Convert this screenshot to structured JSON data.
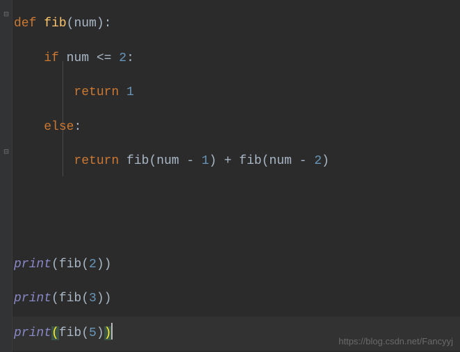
{
  "code": {
    "line1": {
      "kw_def": "def",
      "fn_name": "fib",
      "paren_open": "(",
      "param": "num",
      "paren_close": ")",
      "colon": ":"
    },
    "line2": {
      "kw_if": "if",
      "var": "num",
      "op": "<=",
      "num": "2",
      "colon": ":"
    },
    "line3": {
      "kw_return": "return",
      "num": "1"
    },
    "line4": {
      "kw_else": "else",
      "colon": ":"
    },
    "line5": {
      "kw_return": "return",
      "fn": "fib",
      "po1": "(",
      "var1": "num",
      "minus1": "-",
      "n1": "1",
      "pc1": ")",
      "plus": "+",
      "fn2": "fib",
      "po2": "(",
      "var2": "num",
      "minus2": "-",
      "n2": "2",
      "pc2": ")"
    },
    "line6": {
      "print": "print",
      "po": "(",
      "fn": "fib",
      "po2": "(",
      "num": "2",
      "pc2": ")",
      "pc": ")"
    },
    "line7": {
      "print": "print",
      "po": "(",
      "fn": "fib",
      "po2": "(",
      "num": "3",
      "pc2": ")",
      "pc": ")"
    },
    "line8": {
      "print": "print",
      "po": "(",
      "fn": "fib",
      "po2": "(",
      "num": "5",
      "pc2": ")",
      "pc": ")"
    }
  },
  "watermark": "https://blog.csdn.net/Fancyyj"
}
